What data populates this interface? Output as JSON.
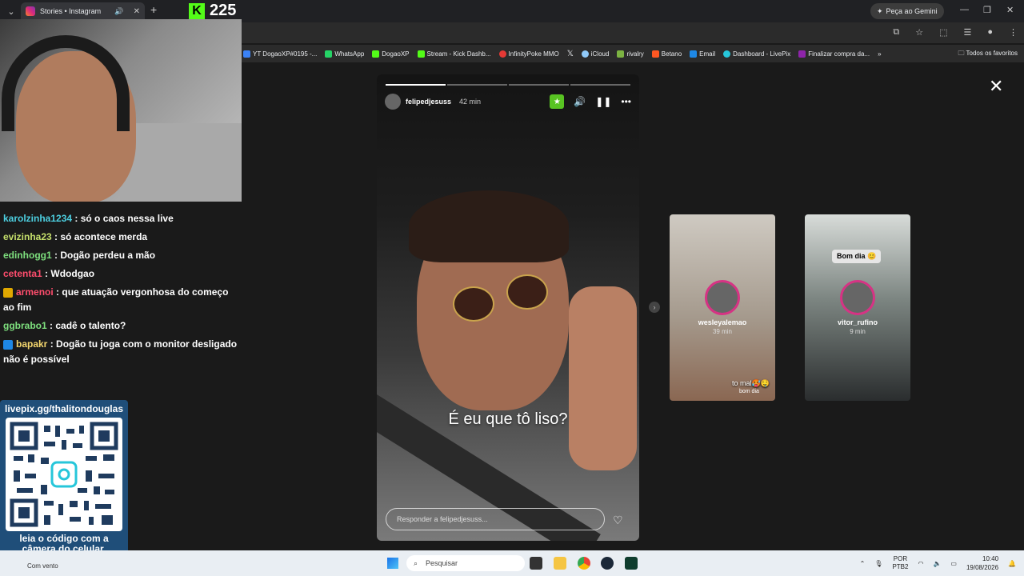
{
  "browser": {
    "tab_title": "Stories • Instagram",
    "tab_close": "✕",
    "new_tab": "+",
    "gemini_label": "Peça ao Gemini",
    "window_controls": [
      "—",
      "❐",
      "✕"
    ],
    "bookmarks": [
      {
        "label": "YT DogaoXP#0195 -...",
        "color": "#3b82f6"
      },
      {
        "label": "WhatsApp",
        "color": "#25d366"
      },
      {
        "label": "DogaoXP",
        "color": "#53fc18"
      },
      {
        "label": "Stream - Kick Dashb...",
        "color": "#53fc18"
      },
      {
        "label": "InfinityPoke MMO",
        "color": "#e53935"
      },
      {
        "label": "",
        "color": "#ffffff"
      },
      {
        "label": "iCloud",
        "color": "#90caf9"
      },
      {
        "label": "rivalry",
        "color": "#7cb342"
      },
      {
        "label": "Betano",
        "color": "#ff5722"
      },
      {
        "label": "Email",
        "color": "#1e88e5"
      },
      {
        "label": "Dashboard - LivePix",
        "color": "#26c6da"
      },
      {
        "label": "Finalizar compra da...",
        "color": "#8e24aa"
      }
    ],
    "bookmarks_more": "»",
    "bookmarks_folder": "Todos os favoritos"
  },
  "stream": {
    "viewer_count": "225",
    "kick_letter": "K"
  },
  "chat": {
    "messages": [
      {
        "user": "karolzinha1234",
        "text": ": só o caos nessa live",
        "color": "#4dd0e1",
        "badge": ""
      },
      {
        "user": "evizinha23",
        "text": ": só acontece merda",
        "color": "#c6e06b",
        "badge": ""
      },
      {
        "user": "edinhogg1",
        "text": ": Dogão perdeu a mão",
        "color": "#7ee07e",
        "badge": ""
      },
      {
        "user": "cetenta1",
        "text": ": Wdodgao",
        "color": "#ff4d6d",
        "badge": ""
      },
      {
        "user": "armenoi",
        "text": ": que atuação vergonhosa do começo ao fim",
        "color": "#ff4d6d",
        "badge": "#e0a800"
      },
      {
        "user": "ggbrabo1",
        "text": ": cadê o talento?",
        "color": "#7ee07e",
        "badge": ""
      },
      {
        "user": "bapakr",
        "text": ": Dogão tu joga com o monitor desligado não é possível",
        "color": "#f5d76e",
        "badge": "#1e88e5"
      }
    ]
  },
  "qr": {
    "url": "livepix.gg/thalitondouglas",
    "caption": "leia o código com a câmera do celular."
  },
  "story": {
    "username": "felipedjesuss",
    "time": "42 min",
    "caption": "É eu que tô liso?",
    "reply_placeholder": "Responder a felipedjesuss...",
    "close": "✕",
    "heart": "♡"
  },
  "previews": [
    {
      "username": "wesleyalemao",
      "time": "39 min",
      "overlay": "to mal🥵🤤",
      "sub": "bom dia"
    },
    {
      "username": "vitor_rufino",
      "time": "9 min",
      "bubble": "Bom dia 😊"
    }
  ],
  "taskbar": {
    "weather": "Com vento",
    "search_placeholder": "Pesquisar",
    "lang_top": "POR",
    "lang_bottom": "PTB2",
    "time": "10:40",
    "date": "19/08/2026"
  }
}
